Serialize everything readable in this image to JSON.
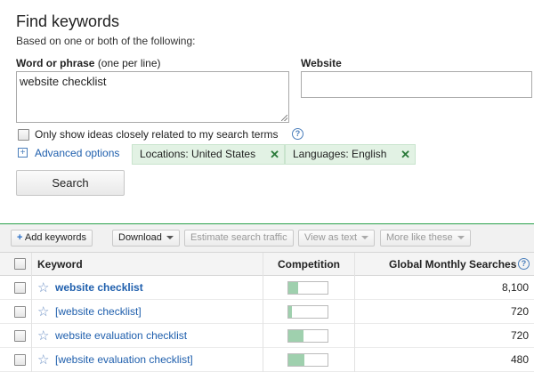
{
  "find": {
    "title": "Find keywords",
    "subtitle": "Based on one or both of the following:",
    "phrase_label": "Word or phrase",
    "phrase_hint": "(one per line)",
    "phrase_value": "website checklist",
    "website_label": "Website",
    "website_value": "",
    "only_show_label": "Only show ideas closely related to my search terms",
    "advanced_label": "Advanced options",
    "chips": [
      "Locations: United States",
      "Languages: English"
    ],
    "search_label": "Search"
  },
  "toolbar": {
    "add_keywords": "Add keywords",
    "download": "Download",
    "estimate": "Estimate search traffic",
    "view_as_text": "View as text",
    "more_like_these": "More like these"
  },
  "table": {
    "headers": {
      "keyword": "Keyword",
      "competition": "Competition",
      "gms": "Global Monthly Searches"
    },
    "rows": [
      {
        "keyword": "website checklist",
        "bold": true,
        "competition": 0.25,
        "gms": "8,100"
      },
      {
        "keyword": "[website checklist]",
        "bold": false,
        "competition": 0.1,
        "gms": "720"
      },
      {
        "keyword": "website evaluation checklist",
        "bold": false,
        "competition": 0.38,
        "gms": "720"
      },
      {
        "keyword": "[website evaluation checklist]",
        "bold": false,
        "competition": 0.42,
        "gms": "480"
      }
    ]
  },
  "colors": {
    "accent_green": "#2aa14a",
    "chip_bg": "#e2f2e4",
    "link_blue": "#1f5fad",
    "bar_fill": "#9fd0ae"
  }
}
